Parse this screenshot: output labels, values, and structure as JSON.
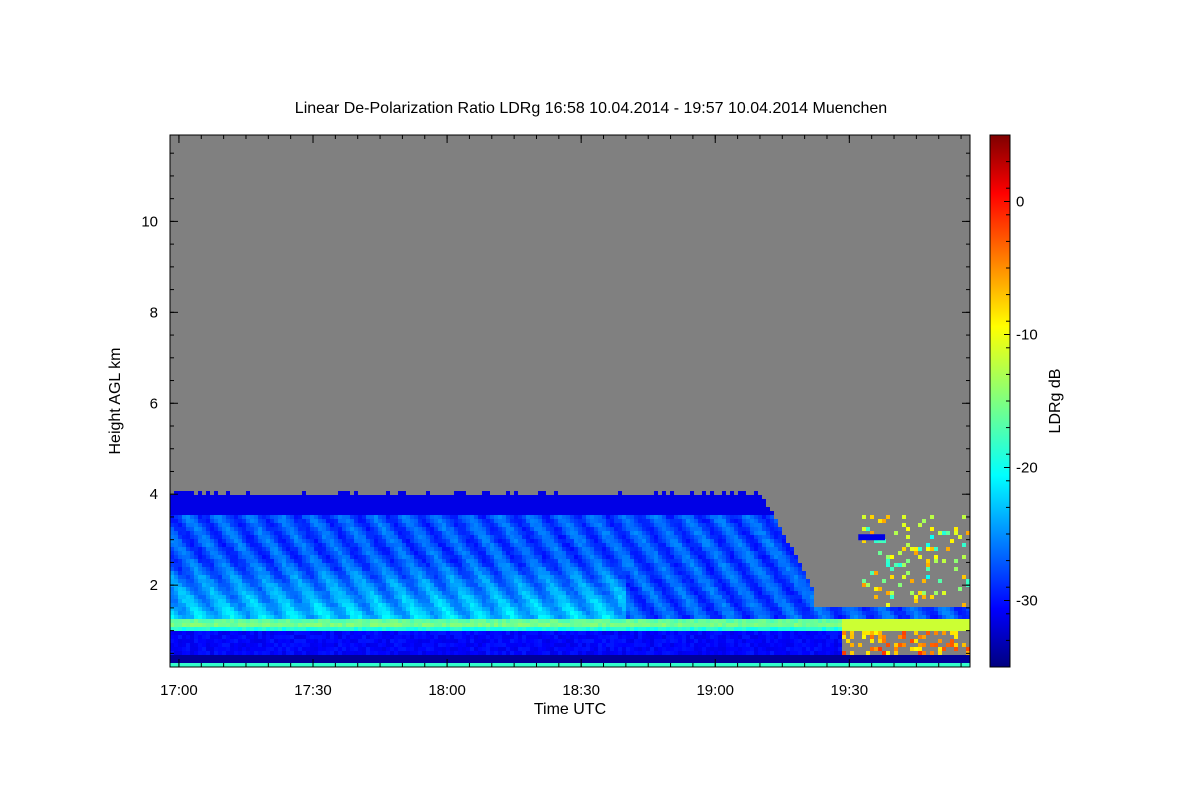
{
  "chart_data": {
    "type": "heatmap",
    "title": "Linear De-Polarization Ratio LDRg   16:58 10.04.2014 - 19:57 10.04.2014 Muenchen",
    "xlabel": "Time UTC",
    "ylabel": "Height AGL km",
    "colorbar_label": "LDRg dB",
    "x_tick_labels": [
      "17:00",
      "17:30",
      "18:00",
      "18:30",
      "19:00",
      "19:30"
    ],
    "y_tick_labels": [
      "2",
      "4",
      "6",
      "8",
      "10"
    ],
    "colorbar_tick_labels": [
      "0",
      "-10",
      "-20",
      "-30"
    ],
    "x_range_minutes": [
      1018,
      1197
    ],
    "x_tick_minutes": [
      1020,
      1050,
      1080,
      1110,
      1140,
      1170
    ],
    "ylim": [
      0.2,
      11.9
    ],
    "y_ticks": [
      2,
      4,
      6,
      8,
      10
    ],
    "color_range_db": [
      -35,
      5
    ],
    "colorbar_ticks": [
      0,
      -10,
      -20,
      -30
    ],
    "colormap": "jet",
    "no_data_color": "#808080",
    "layers": [
      {
        "name": "aerosol layer top",
        "top_km": 4.05,
        "until_minute": 1162
      },
      {
        "name": "bright band",
        "height_km": 1.2,
        "ldr_db": -15
      },
      {
        "name": "lower dark layer",
        "from_km": 0.5,
        "to_km": 1.05,
        "ldr_db": -32
      }
    ]
  }
}
